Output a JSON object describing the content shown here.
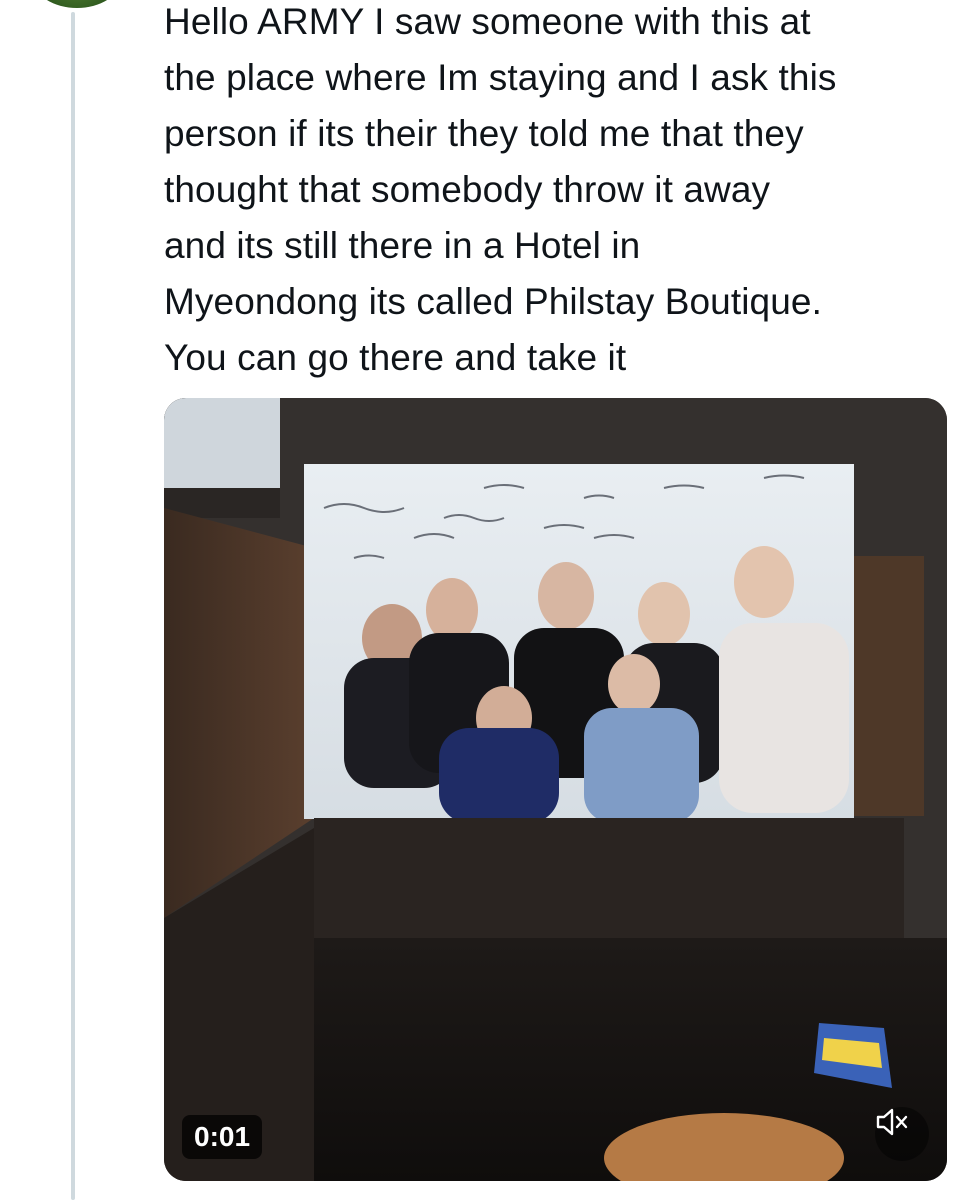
{
  "tweet": {
    "lines": [
      "Hello ARMY I saw someone with this at",
      "the place where Im staying and I ask this",
      "person if its their they told me that they",
      "thought that somebody throw it away",
      "and its still there in a Hotel in",
      "Myeondong its called Philstay Boutique.",
      "You can go there and take it"
    ]
  },
  "video": {
    "timestamp": "0:01",
    "mute_icon": "speaker-muted-icon",
    "description_icon": "video-thumbnail"
  },
  "colors": {
    "text": "#0f1419",
    "thread_line": "#cfd9de",
    "badge_bg": "#000000"
  }
}
